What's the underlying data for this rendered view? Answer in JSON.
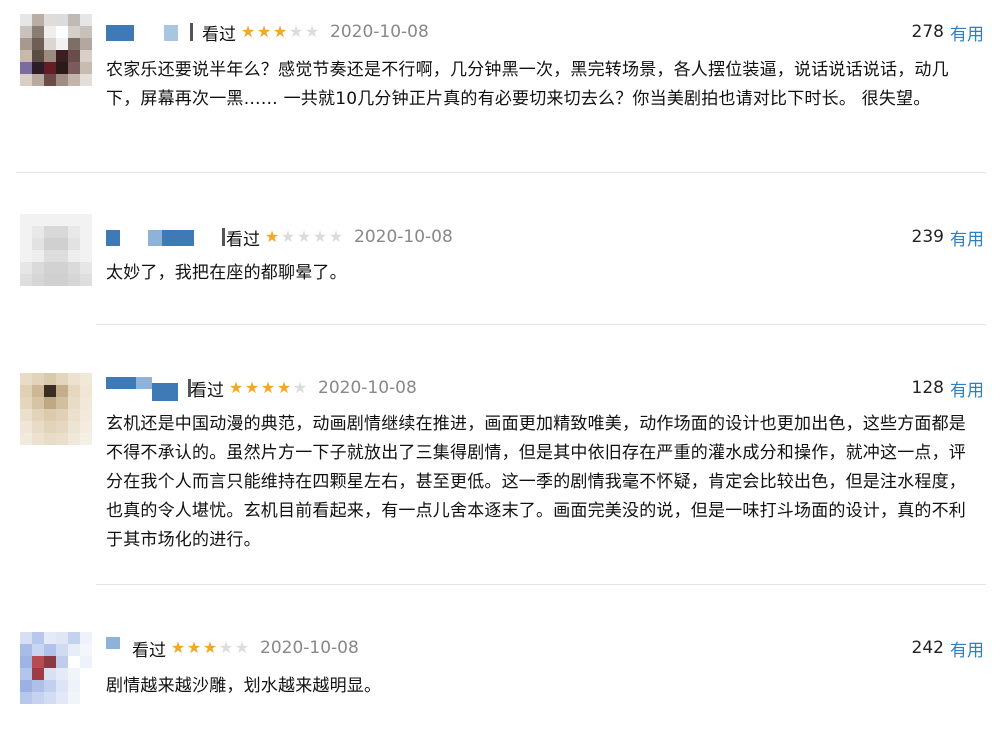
{
  "reviews": [
    {
      "status": "看过",
      "rating": 3,
      "date": "2020-10-08",
      "votes": "278",
      "useful_label": "有用",
      "text": "农家乐还要说半年么？感觉节奏还是不行啊，几分钟黑一次，黑完转场景，各人摆位装逼，说话说话说话，动几下，屏幕再次一黑…… 一共就10几分钟正片真的有必要切来切去么？你当美剧拍也请对比下时长。 很失望。"
    },
    {
      "status": "看过",
      "rating": 1,
      "date": "2020-10-08",
      "votes": "239",
      "useful_label": "有用",
      "text": "太妙了，我把在座的都聊晕了。"
    },
    {
      "status": "看过",
      "rating": 4,
      "date": "2020-10-08",
      "votes": "128",
      "useful_label": "有用",
      "text": "玄机还是中国动漫的典范，动画剧情继续在推进，画面更加精致唯美，动作场面的设计也更加出色，这些方面都是不得不承认的。虽然片方一下子就放出了三集得剧情，但是其中依旧存在严重的灌水成分和操作，就冲这一点，评分在我个人而言只能维持在四颗星左右，甚至更低。这一季的剧情我毫不怀疑，肯定会比较出色，但是注水程度，也真的令人堪忧。玄机目前看起来，有一点儿舍本逐末了。画面完美没的说，但是一味打斗场面的设计，真的不利于其市场化的进行。"
    },
    {
      "status": "看过",
      "rating": 3,
      "date": "2020-10-08",
      "votes": "242",
      "useful_label": "有用",
      "text": "剧情越来越沙雕，划水越来越明显。"
    }
  ],
  "colors": {
    "star_on": "#f5a623",
    "star_off": "#dcdcdc",
    "useful_link": "#2d7fc1",
    "date": "#888888"
  }
}
